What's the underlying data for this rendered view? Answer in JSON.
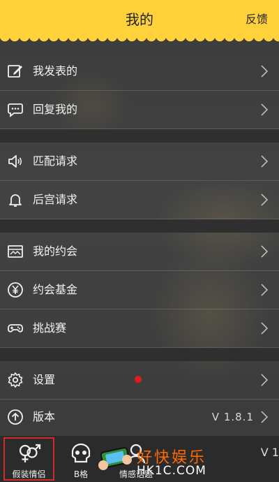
{
  "header": {
    "title": "我的",
    "feedback_label": "反馈"
  },
  "menu": {
    "group1": [
      {
        "label": "我发表的",
        "icon": "edit-icon"
      },
      {
        "label": "回复我的",
        "icon": "chat-bubble-icon"
      }
    ],
    "group2": [
      {
        "label": "匹配请求",
        "icon": "speaker-icon"
      },
      {
        "label": "后宫请求",
        "icon": "bell-icon"
      }
    ],
    "group3": [
      {
        "label": "我的约会",
        "icon": "calendar-icon"
      },
      {
        "label": "约会基金",
        "icon": "yen-coin-icon"
      },
      {
        "label": "挑战赛",
        "icon": "gamepad-icon"
      }
    ],
    "group4": [
      {
        "label": "设置",
        "icon": "gear-icon",
        "has_badge": true,
        "badge_color": "#e31b1b"
      },
      {
        "label": "版本",
        "icon": "arrow-up-circle-icon",
        "value": "V 1.8.1"
      }
    ]
  },
  "tabbar": {
    "tabs": [
      {
        "label": "假装情侣",
        "icon": "gender-couple-icon",
        "active": true
      },
      {
        "label": "B格",
        "icon": "skull-icon"
      },
      {
        "label": "情感话题",
        "icon": "person-icon"
      }
    ],
    "right_fragment": "V 1"
  },
  "watermark": {
    "text": "好快娱乐",
    "sub": "HK1C.COM"
  },
  "colors": {
    "accent": "#ffd23c",
    "badge": "#e31b1b",
    "active_tab_border": "#d42a2a"
  }
}
